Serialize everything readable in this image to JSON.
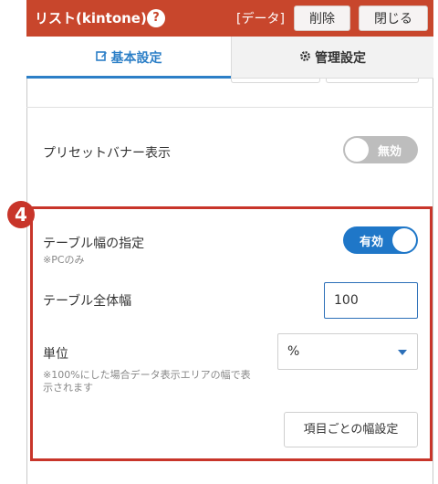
{
  "header": {
    "title": "リスト(kintone)",
    "help_glyph": "?",
    "data_tag": "[データ]",
    "delete_label": "削除",
    "close_label": "閉じる",
    "accent_color": "#c8462c"
  },
  "tabs": [
    {
      "label": "基本設定",
      "icon": "edit-icon",
      "active": true
    },
    {
      "label": "管理設定",
      "icon": "gear-icon",
      "active": false
    }
  ],
  "preset_banner": {
    "label": "プリセットバナー表示",
    "toggle_text": "無効",
    "enabled": false
  },
  "callout_number": "4",
  "table_width": {
    "label": "テーブル幅の指定",
    "note": "※PCのみ",
    "toggle_text": "有効",
    "enabled": true
  },
  "table_total_width": {
    "label": "テーブル全体幅",
    "value": "100"
  },
  "unit": {
    "label": "単位",
    "selected": "%",
    "note_line1": "※100%にした場合データ表示エリアの幅で表",
    "note_line2": "示されます"
  },
  "column_width_button": "項目ごとの幅設定"
}
